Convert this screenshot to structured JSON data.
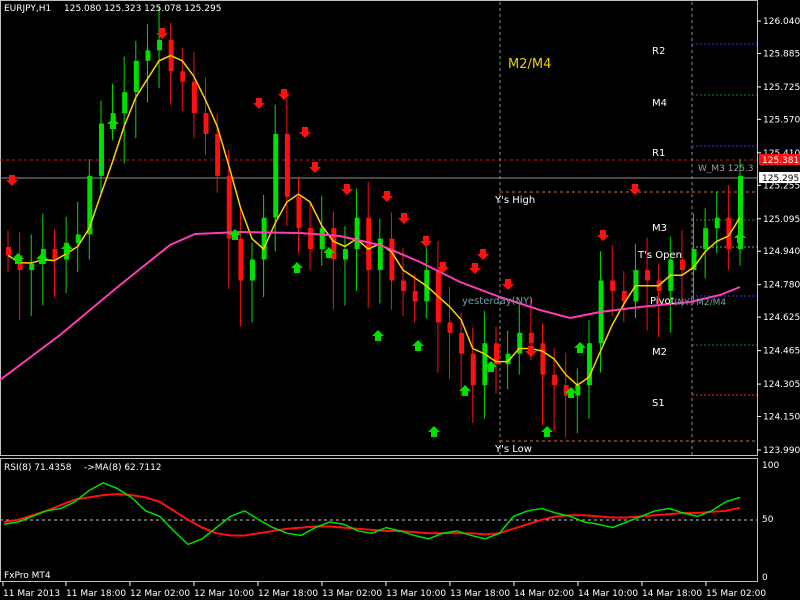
{
  "header": {
    "symbol": "EURJPY,H1",
    "ohlc": "125.080 125.323 125.078 125.295"
  },
  "price_axis": {
    "ticks": [
      "126.040",
      "125.885",
      "125.725",
      "125.570",
      "125.410",
      "125.255",
      "125.095",
      "124.940",
      "124.780",
      "124.625",
      "124.465",
      "124.305",
      "124.150",
      "123.990"
    ],
    "current_price": "125.295",
    "r1_price_box": "125.381"
  },
  "levels": {
    "r2": "R2",
    "m4": "M4",
    "r1": "R1",
    "m3": "M3",
    "t_open": "T's Open",
    "pivot": "Pivot",
    "m2": "M2",
    "s1": "S1",
    "ys_high": "Y's High",
    "ys_low": "Y's Low",
    "yesterday": "yesterday(NY)",
    "ny_m2m4": "(NY) M2/M4",
    "w_m3": "W_M3 125.3",
    "m2m4_title": "M2/M4"
  },
  "rsi": {
    "header": "RSI(8) 71.4358",
    "ma_label": "->MA(8) 62.7112",
    "ticks": [
      "100",
      "50",
      "0"
    ]
  },
  "footer": {
    "broker": "FxPro MT4"
  },
  "time_axis": [
    "11 Mar 2013",
    "11 Mar 18:00",
    "12 Mar 02:00",
    "12 Mar 10:00",
    "12 Mar 18:00",
    "13 Mar 02:00",
    "13 Mar 10:00",
    "13 Mar 18:00",
    "14 Mar 02:00",
    "14 Mar 10:00",
    "14 Mar 18:00",
    "15 Mar 02:00"
  ],
  "colors": {
    "bull": "#00e000",
    "bear": "#ff1010",
    "fast_ma": "#ffd000",
    "slow_ma": "#ff3cb4",
    "rsi_line": "#00e000",
    "rsi_ma": "#ff1010",
    "grid": "#c0c0c0"
  },
  "chart_data": {
    "type": "candlestick",
    "symbol": "EURJPY",
    "timeframe": "H1",
    "ylim": [
      123.99,
      126.1
    ],
    "rsi_ylim": [
      0,
      100
    ],
    "closes": [
      124.92,
      124.85,
      124.88,
      124.95,
      124.9,
      124.98,
      125.02,
      125.3,
      125.55,
      125.6,
      125.7,
      125.85,
      125.9,
      125.95,
      125.8,
      125.75,
      125.6,
      125.5,
      125.3,
      125.0,
      124.8,
      124.9,
      125.1,
      125.5,
      125.2,
      125.05,
      124.95,
      125.05,
      124.9,
      124.95,
      125.1,
      124.85,
      125.0,
      124.8,
      124.75,
      124.7,
      124.85,
      124.6,
      124.55,
      124.45,
      124.3,
      124.5,
      124.4,
      124.45,
      124.55,
      124.5,
      124.35,
      124.3,
      124.25,
      124.3,
      124.5,
      124.8,
      124.75,
      124.7,
      124.85,
      124.8,
      124.75,
      124.9,
      124.85,
      124.95,
      125.05,
      125.1,
      124.95,
      125.3
    ],
    "rsi": [
      48,
      50,
      55,
      60,
      62,
      68,
      78,
      85,
      80,
      72,
      60,
      55,
      42,
      30,
      35,
      45,
      55,
      60,
      52,
      45,
      40,
      38,
      45,
      50,
      48,
      42,
      40,
      45,
      42,
      38,
      35,
      40,
      42,
      38,
      35,
      40,
      55,
      60,
      62,
      58,
      55,
      50,
      48,
      45,
      50,
      55,
      60,
      62,
      58,
      55,
      60,
      68,
      72
    ],
    "rsi_ma": [
      50,
      52,
      56,
      60,
      65,
      70,
      72,
      74,
      75,
      74,
      72,
      68,
      60,
      52,
      45,
      40,
      38,
      38,
      40,
      42,
      44,
      45,
      46,
      46,
      45,
      44,
      43,
      42,
      42,
      41,
      40,
      40,
      40,
      40,
      39,
      40,
      44,
      48,
      52,
      55,
      56,
      56,
      55,
      54,
      54,
      55,
      56,
      57,
      58,
      58,
      59,
      60,
      62.7
    ]
  }
}
